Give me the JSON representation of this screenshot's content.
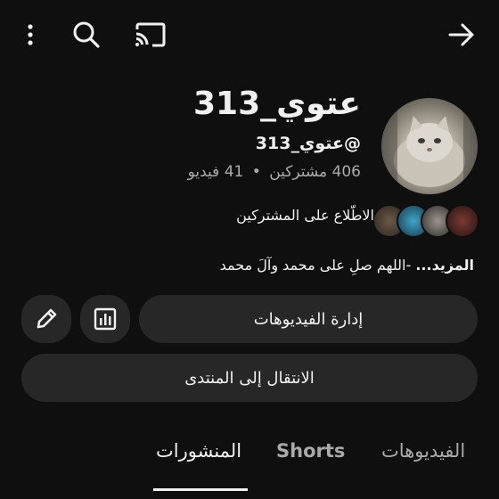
{
  "header": {
    "icons": [
      "more-vert-icon",
      "search-icon",
      "cast-icon",
      "back-arrow-icon"
    ]
  },
  "channel": {
    "name": "عتوي_313",
    "handle": "@عتوي_313",
    "subscribers": "406 مشتركين",
    "separator": "•",
    "videos": "41 فيديو",
    "subscribers_link": "الاطّلاع على المشتركين",
    "description": "-اللهم صلِ على محمد وآلَ محمد",
    "more_label": "...المزيد"
  },
  "actions": {
    "manage_videos": "إدارة الفيديوهات",
    "go_to_community": "الانتقال إلى المنتدى",
    "edit_icon": "pencil-icon",
    "analytics_icon": "analytics-icon"
  },
  "tabs": [
    {
      "label": "الفيديوهات",
      "active": false
    },
    {
      "label": "Shorts",
      "active": false
    },
    {
      "label": "المنشورات",
      "active": true
    }
  ],
  "colors": {
    "background": "#0f0f0f",
    "surface": "#272727",
    "text": "#f1f1f1",
    "muted": "#aaaaaa"
  }
}
